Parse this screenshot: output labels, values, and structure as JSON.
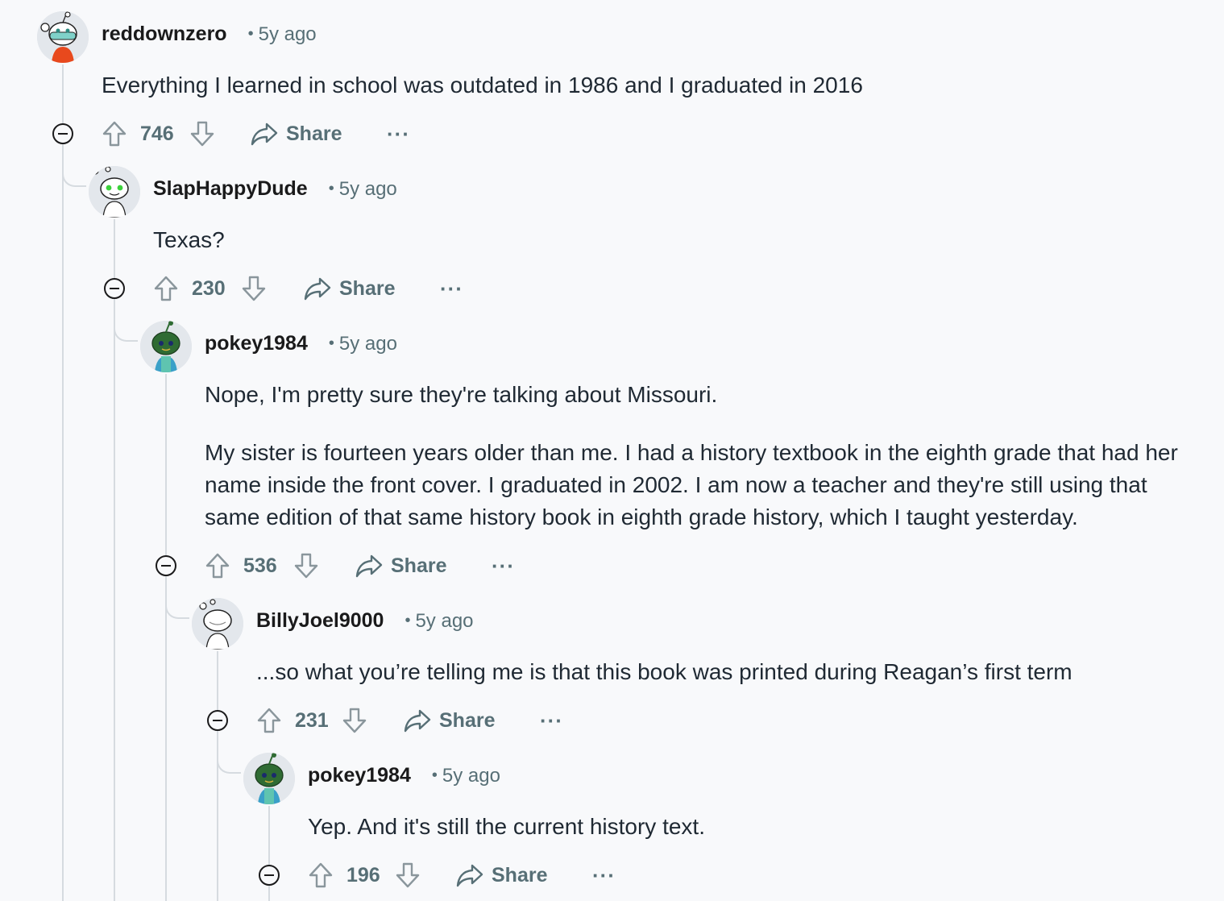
{
  "comments": [
    {
      "username": "reddownzero",
      "time": "5y ago",
      "body": [
        "Everything I learned in school was outdated in 1986 and I graduated in 2016"
      ],
      "score": "746",
      "share_label": "Share",
      "more_label": "···",
      "avatar_icon": "snoo-mask-avatar"
    },
    {
      "username": "SlapHappyDude",
      "time": "5y ago",
      "body": [
        "Texas?"
      ],
      "score": "230",
      "share_label": "Share",
      "more_label": "···",
      "avatar_icon": "snoo-green-eyes-avatar"
    },
    {
      "username": "pokey1984",
      "time": "5y ago",
      "body": [
        "Nope, I'm pretty sure they're talking about Missouri.",
        "My sister is fourteen years older than me. I had a history textbook in the eighth grade that had her name inside the front cover. I graduated in 2002. I am now a teacher and they're still using that same edition of that same history book in eighth grade history, which I taught yesterday."
      ],
      "score": "536",
      "share_label": "Share",
      "more_label": "···",
      "avatar_icon": "snoo-green-avatar"
    },
    {
      "username": "BillyJoel9000",
      "time": "5y ago",
      "body": [
        "...so what you’re telling me is that this book was printed during Reagan’s first term"
      ],
      "score": "231",
      "share_label": "Share",
      "more_label": "···",
      "avatar_icon": "snoo-white-avatar"
    },
    {
      "username": "pokey1984",
      "time": "5y ago",
      "body": [
        "Yep. And it's still the current history text."
      ],
      "score": "196",
      "share_label": "Share",
      "more_label": "···",
      "avatar_icon": "snoo-green-avatar"
    }
  ],
  "colors": {
    "background": "#f8f9fb",
    "thread_line": "#d6dbe0",
    "meta_text": "#576f76"
  }
}
